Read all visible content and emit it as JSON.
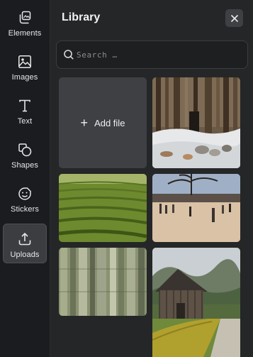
{
  "sidebar": {
    "items": [
      {
        "label": "Elements",
        "icon": "elements-icon"
      },
      {
        "label": "Images",
        "icon": "image-icon"
      },
      {
        "label": "Text",
        "icon": "text-icon"
      },
      {
        "label": "Shapes",
        "icon": "shapes-icon"
      },
      {
        "label": "Stickers",
        "icon": "sticker-icon"
      },
      {
        "label": "Uploads",
        "icon": "upload-icon",
        "active": true
      }
    ]
  },
  "panel": {
    "title": "Library",
    "search_placeholder": "Search …",
    "add_file_label": "Add file",
    "images": [
      {
        "subject": "winter forest with snow and rocks"
      },
      {
        "subject": "green tea plantation rows"
      },
      {
        "subject": "people walking on frozen lake"
      },
      {
        "subject": "bamboo stalks"
      },
      {
        "subject": "wooden barn with green hedge and mountains"
      }
    ]
  },
  "colors": {
    "rail_bg": "#1a1c1f",
    "panel_bg": "#252627",
    "tile_bg": "#3f4044",
    "text": "#f2f3f4"
  }
}
